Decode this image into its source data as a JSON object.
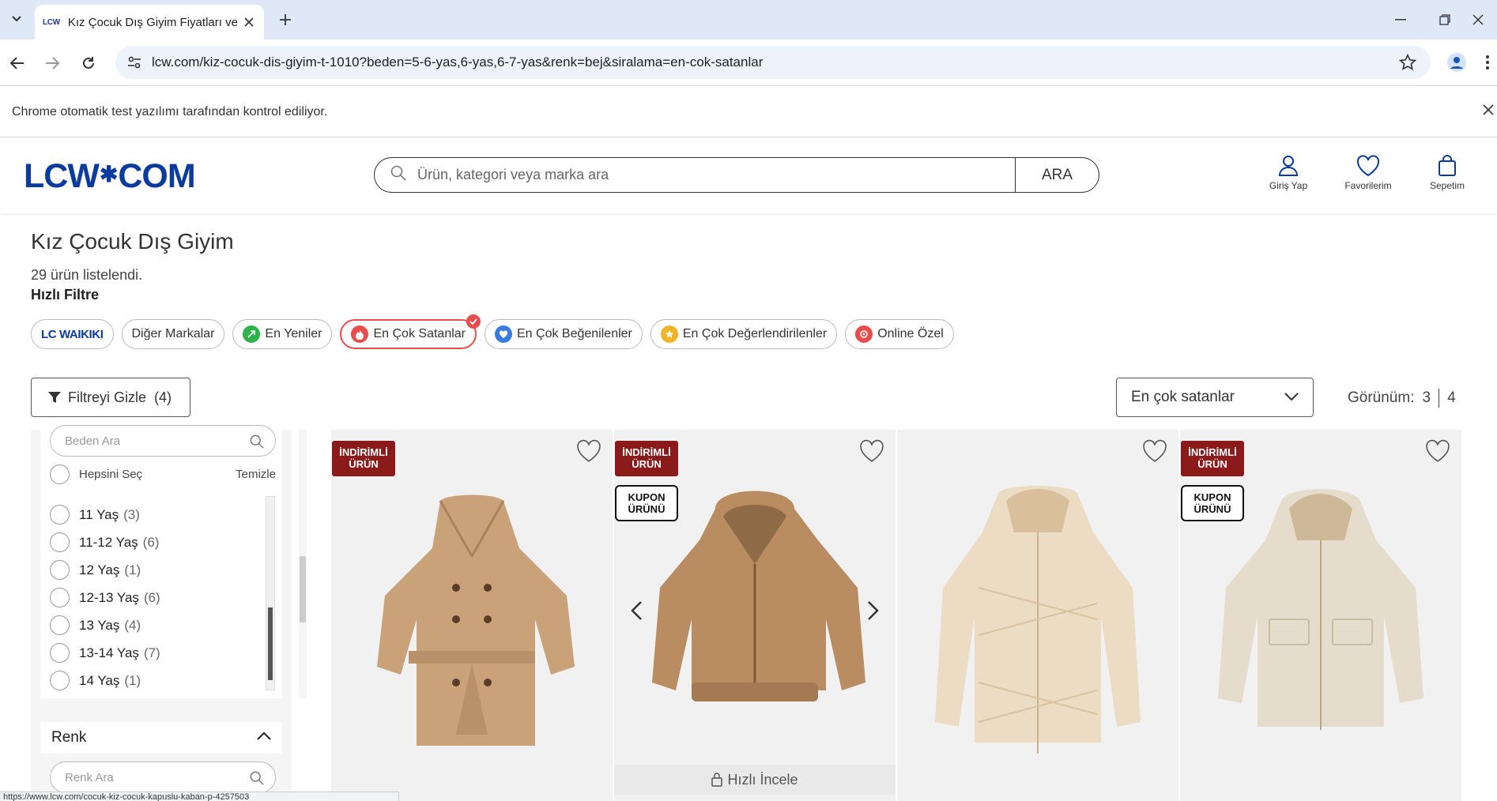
{
  "browser": {
    "tab_favicon": "LCW",
    "tab_title": "Kız Çocuk Dış Giyim Fiyatları ve",
    "url": "lcw.com/kiz-cocuk-dis-giyim-t-1010?beden=5-6-yas,6-yas,6-7-yas&renk=bej&siralama=en-cok-satanlar",
    "infobar_text": "Chrome otomatik test yazılımı tarafından kontrol ediliyor.",
    "status_url": "https://www.lcw.com/cocuk-kiz-cocuk-kapuslu-kaban-p-4257503"
  },
  "header": {
    "logo_left": "LCW",
    "logo_star": "✱",
    "logo_right": "COM",
    "search_placeholder": "Ürün, kategori veya marka ara",
    "search_button": "ARA",
    "actions": [
      {
        "label": "Giriş Yap",
        "icon": "user-icon"
      },
      {
        "label": "Favorilerim",
        "icon": "heart-icon"
      },
      {
        "label": "Sepetim",
        "icon": "bag-icon"
      }
    ]
  },
  "page": {
    "title": "Kız Çocuk Dış Giyim",
    "count": "29 ürün listelendi.",
    "quick_filter_label": "Hızlı Filtre",
    "chips": [
      {
        "label": "LC WAIKIKI",
        "icon": "lcw-logo-icon"
      },
      {
        "label": "Diğer Markalar",
        "icon": ""
      },
      {
        "label": "En Yeniler",
        "icon": "new-icon",
        "color": "#2db34a"
      },
      {
        "label": "En Çok Satanlar",
        "icon": "fire-icon",
        "color": "#e84c4c",
        "active": true
      },
      {
        "label": "En Çok Beğenilenler",
        "icon": "heart-icon",
        "color": "#3a7be0"
      },
      {
        "label": "En Çok Değerlendirilenler",
        "icon": "star-icon",
        "color": "#f0b429"
      },
      {
        "label": "Online Özel",
        "icon": "online-icon",
        "color": "#e84c4c"
      }
    ],
    "filter_button": "Filtreyi Gizle",
    "filter_count": "(4)",
    "sort_value": "En çok satanlar",
    "view_label": "Görünüm:",
    "view_options": [
      "3",
      "4"
    ]
  },
  "sidebar": {
    "size_search_placeholder": "Beden Ara",
    "select_all": "Hepsini Seç",
    "clear": "Temizle",
    "sizes": [
      {
        "label": "11 Yaş",
        "count": "(3)"
      },
      {
        "label": "11-12 Yaş",
        "count": "(6)"
      },
      {
        "label": "12 Yaş",
        "count": "(1)"
      },
      {
        "label": "12-13 Yaş",
        "count": "(6)"
      },
      {
        "label": "13 Yaş",
        "count": "(4)"
      },
      {
        "label": "13-14 Yaş",
        "count": "(7)"
      },
      {
        "label": "14 Yaş",
        "count": "(1)"
      }
    ],
    "color_section": "Renk",
    "color_search_placeholder": "Renk Ara"
  },
  "products": [
    {
      "badge": "İNDİRİMLİ ÜRÜN",
      "coupon": "",
      "garment": "trench",
      "color": "#c9a27a"
    },
    {
      "badge": "İNDİRİMLİ ÜRÜN",
      "coupon": "KUPON ÜRÜNÜ",
      "garment": "fur",
      "color": "#b98c62",
      "quick_view": "Hızlı İncele"
    },
    {
      "badge": "",
      "coupon": "",
      "garment": "puffer",
      "color": "#ecdcc3"
    },
    {
      "badge": "İNDİRİMLİ ÜRÜN",
      "coupon": "KUPON ÜRÜNÜ",
      "garment": "parka",
      "color": "#e6dccb"
    }
  ],
  "colors": {
    "brand": "#0b3b9c",
    "badge": "#8b1a1a",
    "active_chip": "#e84c4c"
  }
}
